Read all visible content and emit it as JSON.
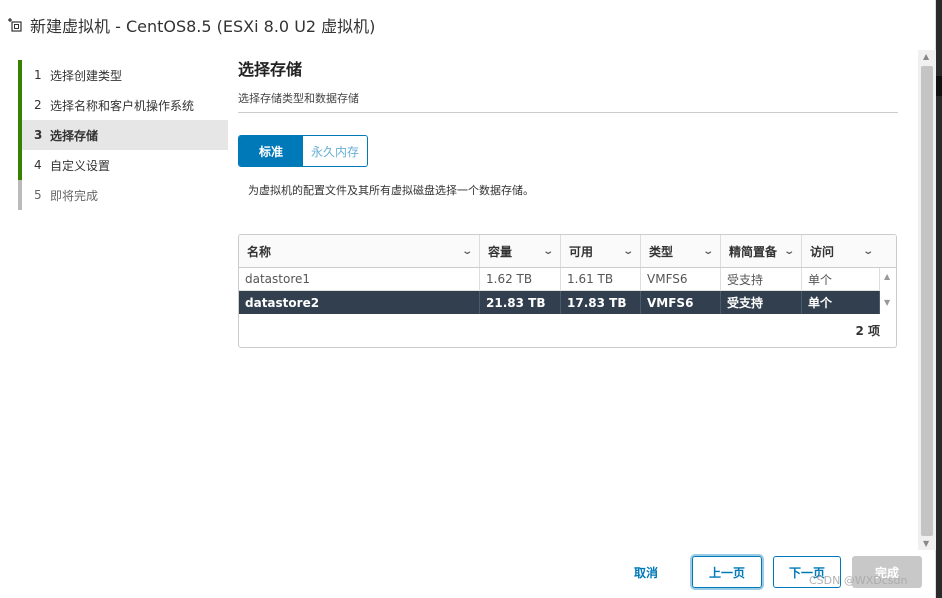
{
  "window": {
    "title": "新建虚拟机 - CentOS8.5 (ESXi 8.0 U2 虚拟机)",
    "title_icon": "new-vm-icon"
  },
  "nav": {
    "items": [
      {
        "num": "1",
        "label": "选择创建类型"
      },
      {
        "num": "2",
        "label": "选择名称和客户机操作系统"
      },
      {
        "num": "3",
        "label": "选择存储"
      },
      {
        "num": "4",
        "label": "自定义设置"
      },
      {
        "num": "5",
        "label": "即将完成"
      }
    ],
    "active_index": 2
  },
  "main": {
    "title": "选择存储",
    "subtitle": "选择存储类型和数据存储",
    "tabs": [
      {
        "label": "标准",
        "selected": true
      },
      {
        "label": "永久内存",
        "selected": false
      }
    ],
    "description": "为虚拟机的配置文件及其所有虚拟磁盘选择一个数据存储。"
  },
  "grid": {
    "columns": [
      "名称",
      "容量",
      "可用",
      "类型",
      "精简置备",
      "访问"
    ],
    "rows": [
      {
        "name": "datastore1",
        "capacity": "1.62 TB",
        "free": "1.61 TB",
        "type": "VMFS6",
        "thin": "受支持",
        "access": "单个",
        "selected": false
      },
      {
        "name": "datastore2",
        "capacity": "21.83 TB",
        "free": "17.83 TB",
        "type": "VMFS6",
        "thin": "受支持",
        "access": "单个",
        "selected": true
      }
    ],
    "footer": "2 项"
  },
  "buttons": {
    "cancel": "取消",
    "prev": "上一页",
    "next": "下一页",
    "finish": "完成"
  },
  "watermark": "CSDN @WXDcsdn",
  "colors": {
    "accent": "#0079b8",
    "nav_done": "#388000",
    "selected_row": "#313f4f"
  }
}
